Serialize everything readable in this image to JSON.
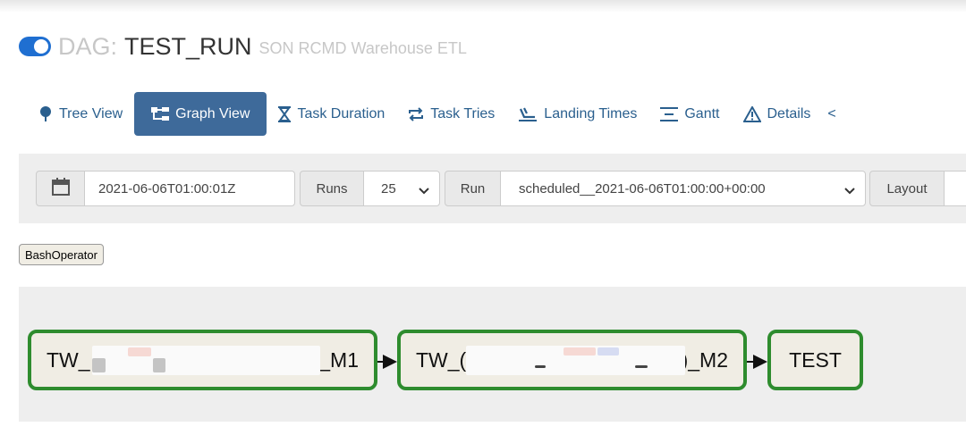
{
  "header": {
    "dag_prefix": "DAG:",
    "dag_id": "TEST_RUN",
    "description": "SON RCMD Warehouse ETL",
    "paused_toggle_on": true
  },
  "nav": {
    "tabs": [
      {
        "label": "Tree View",
        "icon": "tree-icon"
      },
      {
        "label": "Graph View",
        "icon": "graph-icon",
        "active": true
      },
      {
        "label": "Task Duration",
        "icon": "hourglass-icon"
      },
      {
        "label": "Task Tries",
        "icon": "retry-icon"
      },
      {
        "label": "Landing Times",
        "icon": "landing-icon"
      },
      {
        "label": "Gantt",
        "icon": "gantt-icon"
      },
      {
        "label": "Details",
        "icon": "warning-icon"
      }
    ],
    "more_label": "<"
  },
  "toolbar": {
    "base_date": "2021-06-06T01:00:01Z",
    "runs_label": "Runs",
    "runs_value": "25",
    "run_label": "Run",
    "run_value": "scheduled__2021-06-06T01:00:00+00:00",
    "layout_label": "Layout"
  },
  "legend": {
    "operator": "BashOperator"
  },
  "graph": {
    "nodes": [
      {
        "prefix": "TW_",
        "suffix": ")_M1",
        "state": "success"
      },
      {
        "prefix": "TW_(",
        "suffix": ")_M2",
        "state": "success"
      },
      {
        "label": "TEST",
        "state": "success"
      }
    ],
    "colors": {
      "success_border": "#2e8c2e",
      "node_fill": "#f0ede4"
    }
  }
}
